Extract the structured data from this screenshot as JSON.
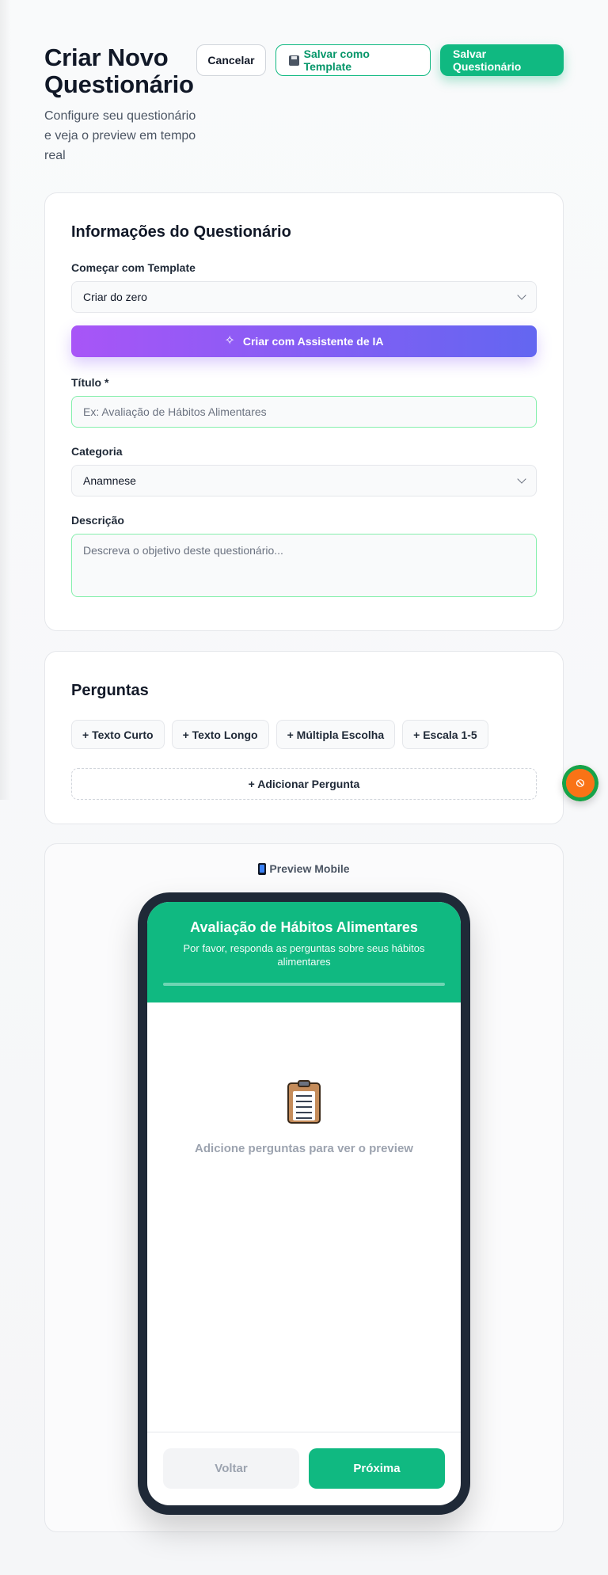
{
  "header": {
    "title": "Criar Novo Questionário",
    "subtitle": "Configure seu questionário e veja o preview em tempo real",
    "cancel_label": "Cancelar",
    "save_template_label": "Salvar como Template",
    "save_label": "Salvar Questionário"
  },
  "info": {
    "title": "Informações do Questionário",
    "template_label": "Começar com Template",
    "template_value": "Criar do zero",
    "ai_button_label": "Criar com Assistente de IA",
    "title_label": "Título *",
    "title_placeholder": "Ex: Avaliação de Hábitos Alimentares",
    "category_label": "Categoria",
    "category_value": "Anamnese",
    "description_label": "Descrição",
    "description_placeholder": "Descreva o objetivo deste questionário..."
  },
  "questions": {
    "title": "Perguntas",
    "types": [
      "+ Texto Curto",
      "+ Texto Longo",
      "+ Múltipla Escolha",
      "+ Escala 1-5"
    ],
    "add_label": "+ Adicionar Pergunta"
  },
  "preview": {
    "label": "Preview Mobile",
    "screen_title": "Avaliação de Hábitos Alimentares",
    "screen_subtitle": "Por favor, responda as perguntas sobre seus hábitos alimentares",
    "progress": 0,
    "empty_icon": "clipboard-icon",
    "empty_text": "Adicione perguntas para ver o preview",
    "back_label": "Voltar",
    "next_label": "Próxima"
  },
  "colors": {
    "accent": "#10b981",
    "ai_gradient_start": "#a855f7",
    "ai_gradient_end": "#6366f1",
    "phone_frame": "#1f2937"
  }
}
